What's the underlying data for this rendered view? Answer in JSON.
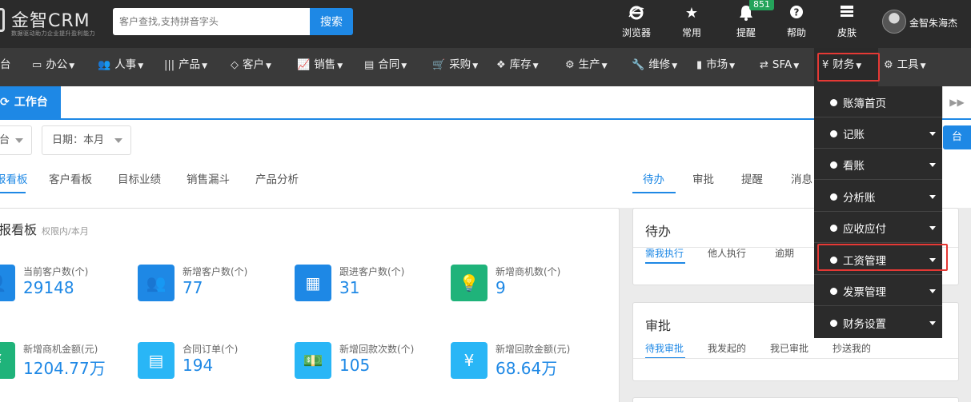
{
  "header": {
    "logo_text": "金智CRM",
    "logo_sub": "数据驱动助力企业提升盈利能力",
    "search_placeholder": "客户查找,支持拼音字头",
    "search_button": "搜索",
    "tools": [
      {
        "label": "浏览器",
        "icon": "browser-icon"
      },
      {
        "label": "常用",
        "icon": "star-icon"
      },
      {
        "label": "提醒",
        "icon": "bell-icon",
        "badge": "851"
      },
      {
        "label": "帮助",
        "icon": "help-icon"
      },
      {
        "label": "皮肤",
        "icon": "skin-icon"
      }
    ],
    "user_name": "金智朱海杰"
  },
  "nav": {
    "items": [
      {
        "label": "台",
        "icon": ""
      },
      {
        "label": "办公",
        "icon": "laptop-icon"
      },
      {
        "label": "人事",
        "icon": "users-icon"
      },
      {
        "label": "产品",
        "icon": "barcode-icon"
      },
      {
        "label": "客户",
        "icon": "diamond-icon"
      },
      {
        "label": "销售",
        "icon": "chart-icon"
      },
      {
        "label": "合同",
        "icon": "contract-icon"
      },
      {
        "label": "采购",
        "icon": "cart-icon"
      },
      {
        "label": "库存",
        "icon": "cubes-icon"
      },
      {
        "label": "生产",
        "icon": "cogs-icon"
      },
      {
        "label": "维修",
        "icon": "wrench-icon"
      },
      {
        "label": "市场",
        "icon": "bookmark-icon"
      },
      {
        "label": "SFA",
        "icon": "retweet-icon"
      },
      {
        "label": "财务",
        "icon": "yen-icon"
      },
      {
        "label": "工具",
        "icon": "gear-icon"
      }
    ]
  },
  "tabbar": {
    "active_tab": "工作台"
  },
  "filters": {
    "scope_label": "台",
    "date_label": "日期：本月",
    "right_button": "台"
  },
  "subtabs": [
    "报看板",
    "客户看板",
    "目标业绩",
    "销售漏斗",
    "产品分析"
  ],
  "right_tabs": [
    "待办",
    "审批",
    "提醒",
    "消息"
  ],
  "board": {
    "title": "报看板",
    "subtitle": "权限内/本月",
    "stats": [
      {
        "label": "当前客户数(个)",
        "value": "29148",
        "color": "#1e88e5"
      },
      {
        "label": "新增客户数(个)",
        "value": "77",
        "color": "#1e88e5"
      },
      {
        "label": "跟进客户数(个)",
        "value": "31",
        "color": "#1e88e5"
      },
      {
        "label": "新增商机数(个)",
        "value": "9",
        "color": "#1fb37a"
      },
      {
        "label": "新增商机金额(元)",
        "value": "1204.77万",
        "color": "#1fb37a"
      },
      {
        "label": "合同订单(个)",
        "value": "194",
        "color": "#29b6f6"
      },
      {
        "label": "新增回款次数(个)",
        "value": "105",
        "color": "#29b6f6"
      },
      {
        "label": "新增回款金额(元)",
        "value": "68.64万",
        "color": "#29b6f6"
      }
    ]
  },
  "todo": {
    "title": "待办",
    "tabs": [
      "需我执行",
      "他人执行",
      "逾期"
    ]
  },
  "approval": {
    "title": "审批",
    "tabs": [
      "待我审批",
      "我发起的",
      "我已审批",
      "抄送我的"
    ]
  },
  "finance_menu": {
    "items": [
      "账簿首页",
      "记账",
      "看账",
      "分析账",
      "应收应付",
      "工资管理",
      "发票管理",
      "财务设置"
    ]
  }
}
